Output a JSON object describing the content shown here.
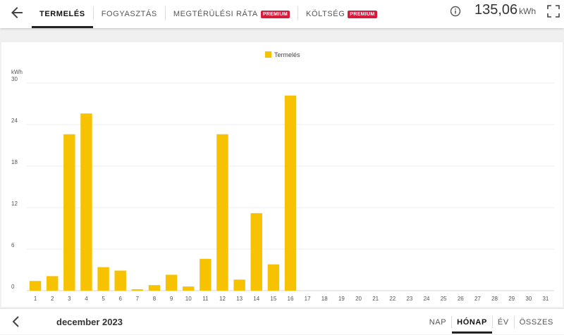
{
  "header": {
    "back_icon": "arrow-left-icon",
    "tabs": [
      {
        "label": "TERMELÉS",
        "active": true,
        "premium": false
      },
      {
        "label": "FOGYASZTÁS",
        "active": false,
        "premium": false
      },
      {
        "label": "MEGTÉRÜLÉSI RÁTA",
        "active": false,
        "premium": true
      },
      {
        "label": "KÖLTSÉG",
        "active": false,
        "premium": true
      }
    ],
    "premium_badge": "PREMIUM",
    "info_icon": "info-icon",
    "total_value": "135,06",
    "total_unit": "kWh",
    "fullscreen_icon": "fullscreen-icon"
  },
  "footer": {
    "prev_icon": "chevron-left-icon",
    "period": "december 2023",
    "ranges": [
      {
        "label": "NAP",
        "active": false
      },
      {
        "label": "HÓNAP",
        "active": true
      },
      {
        "label": "ÉV",
        "active": false
      },
      {
        "label": "ÖSSZES",
        "active": false
      }
    ]
  },
  "colors": {
    "bar": "#f7c200",
    "grid": "#ececec",
    "axis_text": "#555555"
  },
  "chart_data": {
    "type": "bar",
    "legend": "Termelés",
    "ylabel": "kWh",
    "ylim": [
      0,
      30
    ],
    "yticks": [
      0,
      6,
      12,
      18,
      24,
      30
    ],
    "categories": [
      "1",
      "2",
      "3",
      "4",
      "5",
      "6",
      "7",
      "8",
      "9",
      "10",
      "11",
      "12",
      "13",
      "14",
      "15",
      "16",
      "17",
      "18",
      "19",
      "20",
      "21",
      "22",
      "23",
      "24",
      "25",
      "26",
      "27",
      "28",
      "29",
      "30",
      "31"
    ],
    "series": [
      {
        "name": "Termelés",
        "values": [
          1.4,
          2.1,
          22.6,
          25.6,
          3.4,
          2.9,
          0.2,
          0.8,
          2.3,
          0.6,
          4.6,
          22.6,
          1.6,
          11.2,
          3.8,
          28.2,
          0,
          0,
          0,
          0,
          0,
          0,
          0,
          0,
          0,
          0,
          0,
          0,
          0,
          0,
          0
        ]
      }
    ]
  }
}
